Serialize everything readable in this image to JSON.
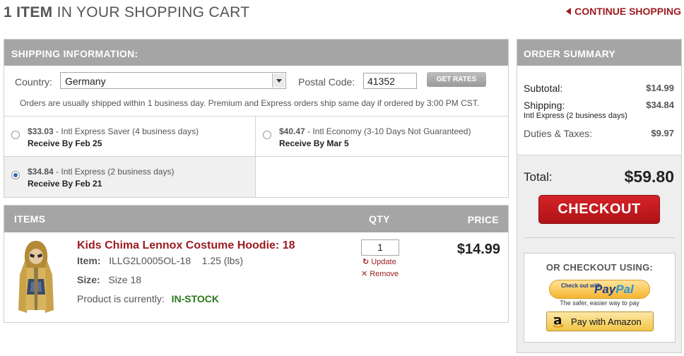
{
  "header": {
    "title_bold": "1 ITEM",
    "title_rest": "IN YOUR SHOPPING CART",
    "continue_label": "CONTINUE SHOPPING"
  },
  "shipping": {
    "heading": "SHIPPING INFORMATION:",
    "country_label": "Country:",
    "country_value": "Germany",
    "postal_label": "Postal Code:",
    "postal_value": "41352",
    "get_rates_label": "GET RATES",
    "note": "Orders are usually shipped within 1 business day. Premium and Express orders ship same day if ordered by 3:00 PM CST.",
    "options": [
      {
        "price": "$33.03",
        "desc": " - Intl Express Saver (4 business days)",
        "receive": "Receive By Feb 25",
        "selected": false
      },
      {
        "price": "$40.47",
        "desc": " - Intl Economy (3-10 Days Not Guaranteed)",
        "receive": "Receive By Mar 5",
        "selected": false
      },
      {
        "price": "$34.84",
        "desc": " - Intl Express (2 business days)",
        "receive": "Receive By Feb 21",
        "selected": true
      }
    ]
  },
  "items": {
    "col_items": "ITEMS",
    "col_qty": "QTY",
    "col_price": "PRICE",
    "product": {
      "name": "Kids Chima Lennox Costume Hoodie: 18",
      "item_label": "Item:",
      "item_sku": "ILLG2L0005OL-18",
      "weight": "1.25 (lbs)",
      "size_label": "Size:",
      "size_value": "Size 18",
      "status_label": "Product is currently:",
      "status_value": "IN-STOCK",
      "qty": "1",
      "update_label": "Update",
      "remove_label": "Remove",
      "price": "$14.99"
    }
  },
  "summary": {
    "heading": "ORDER SUMMARY",
    "subtotal_label": "Subtotal:",
    "subtotal_value": "$14.99",
    "shipping_label": "Shipping:",
    "shipping_value": "$34.84",
    "shipping_method": "Intl Express (2 business days)",
    "duties_label": "Duties & Taxes:",
    "duties_value": "$9.97",
    "total_label": "Total:",
    "total_value": "$59.80",
    "checkout_label": "CHECKOUT",
    "alt_heading": "OR CHECKOUT USING:",
    "paypal_checkout": "Check out with",
    "paypal_brand_1": "Pay",
    "paypal_brand_2": "Pal",
    "paypal_tagline": "The safer, easier way to pay",
    "amazon_label": "Pay with Amazon"
  },
  "colors": {
    "accent": "#9b1b1f",
    "header_bar": "#a5a5a5",
    "checkout_red": "#c41a1f",
    "in_stock_green": "#2a7a1b"
  }
}
